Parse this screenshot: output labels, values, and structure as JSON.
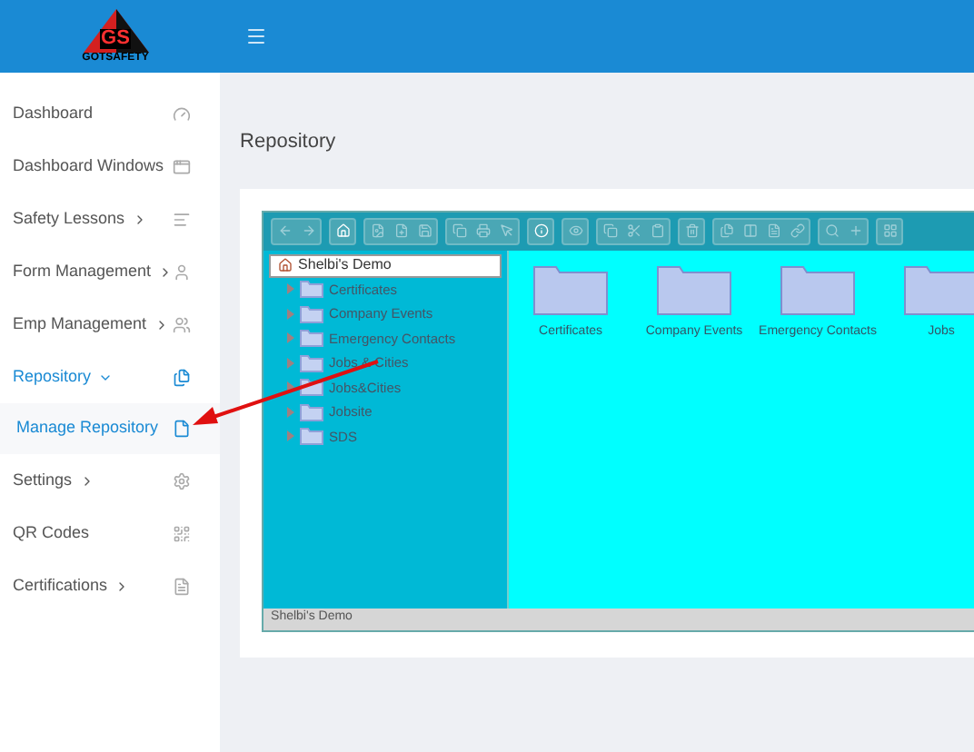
{
  "header": {
    "logo_text": "GS",
    "brand": "GOTSAFETY"
  },
  "sidebar": {
    "items": [
      {
        "label": "Dashboard",
        "submenu": false,
        "active": false
      },
      {
        "label": "Dashboard Windows",
        "submenu": false,
        "active": false
      },
      {
        "label": "Safety Lessons",
        "submenu": true,
        "expanded": false,
        "active": false
      },
      {
        "label": "Form Management",
        "submenu": true,
        "expanded": false,
        "active": false
      },
      {
        "label": "Emp Management",
        "submenu": true,
        "expanded": false,
        "active": false
      },
      {
        "label": "Repository",
        "submenu": true,
        "expanded": true,
        "active": true,
        "children": [
          {
            "label": "Manage Repository",
            "selected": true
          }
        ]
      },
      {
        "label": "Settings",
        "submenu": true,
        "expanded": false,
        "active": false
      },
      {
        "label": "QR Codes",
        "submenu": false,
        "active": false
      },
      {
        "label": "Certifications",
        "submenu": true,
        "expanded": false,
        "active": false
      }
    ]
  },
  "page_title": "Repository",
  "repository": {
    "root": "Shelbi's Demo",
    "tree": [
      {
        "label": "Certificates"
      },
      {
        "label": "Company Events"
      },
      {
        "label": "Emergency Contacts"
      },
      {
        "label": "Jobs & Cities"
      },
      {
        "label": "Jobs&Cities"
      },
      {
        "label": "Jobsite"
      },
      {
        "label": "SDS"
      }
    ],
    "files": [
      {
        "label": "Certificates"
      },
      {
        "label": "Company Events"
      },
      {
        "label": "Emergency Contacts"
      },
      {
        "label": "Jobs"
      }
    ],
    "status_bar": "Shelbi's Demo"
  }
}
